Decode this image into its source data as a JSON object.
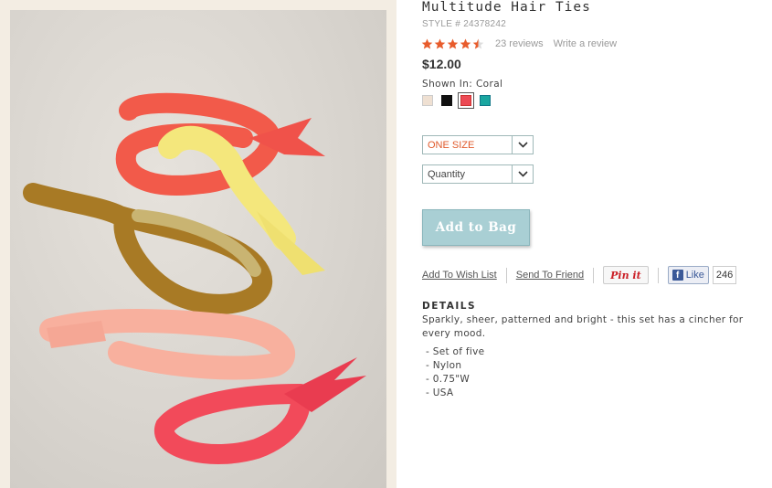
{
  "product": {
    "title": "Multitude Hair Ties",
    "style_number": "STYLE # 24378242",
    "rating": 4.5,
    "reviews_label": "23 reviews",
    "write_review_label": "Write a review",
    "price": "$12.00",
    "shown_in": "Shown In: Coral"
  },
  "swatches": [
    {
      "name": "cream",
      "color": "#efe0d2"
    },
    {
      "name": "black",
      "color": "#111111"
    },
    {
      "name": "coral",
      "color": "#ec4a55",
      "selected": true
    },
    {
      "name": "teal",
      "color": "#1aa6a0"
    }
  ],
  "selects": {
    "size_value": "ONE SIZE",
    "quantity_value": "Quantity"
  },
  "add_to_bag_label": "Add to Bag",
  "actions": {
    "wish_list": "Add To Wish List",
    "send_to_friend": "Send To Friend",
    "pin_it": "Pin it",
    "fb_like": "Like",
    "fb_count": "246"
  },
  "details": {
    "heading": "DETAILS",
    "description": "Sparkly, sheer, patterned and bright - this set has a cincher for every mood.",
    "bullets": [
      "- Set of five",
      "- Nylon",
      "- 0.75\"W",
      "- USA"
    ]
  },
  "colors": {
    "star": "#e85c2c",
    "accent_orange": "#e05a2b",
    "button_teal": "#a9cfd4"
  }
}
